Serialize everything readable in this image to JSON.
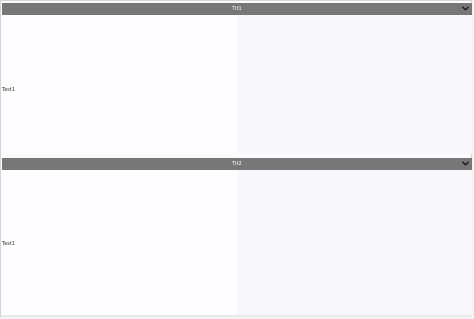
{
  "panels": [
    {
      "title": "Tit1",
      "body_text": "Test1",
      "expanded": true,
      "icon": "chevron-down-icon"
    },
    {
      "title": "Tit2",
      "body_text": "Test1",
      "expanded": true,
      "icon": "chevron-down-icon"
    }
  ],
  "colors": {
    "header_bg": "#777777",
    "header_text": "#ffffff",
    "body_bg": "#fdfcfe"
  }
}
